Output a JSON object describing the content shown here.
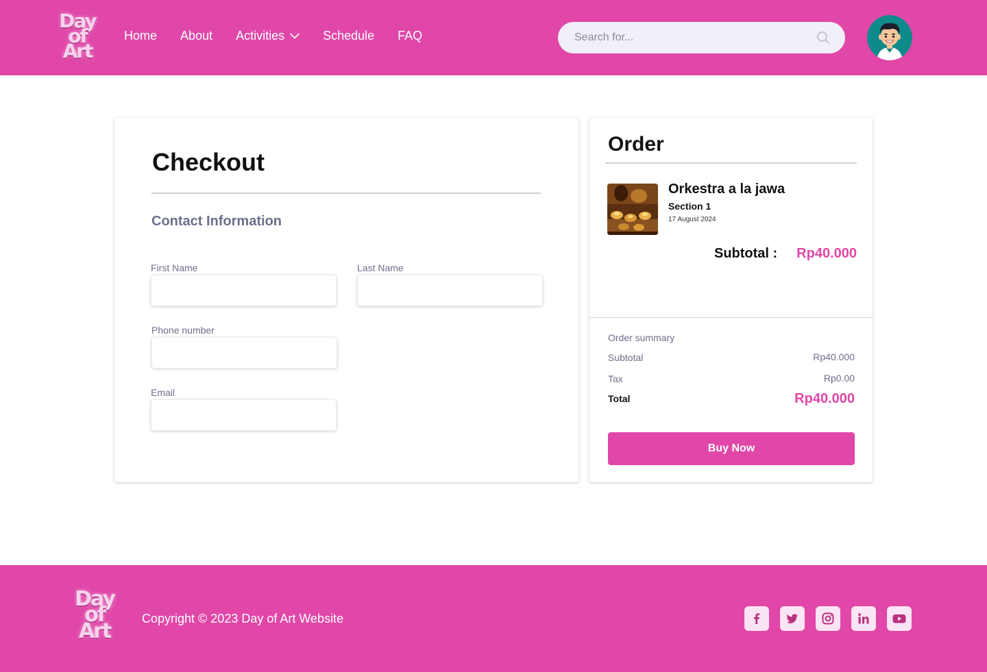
{
  "brand": {
    "logo_lines": [
      "Day",
      "of",
      "Art"
    ]
  },
  "nav": {
    "items": [
      {
        "label": "Home"
      },
      {
        "label": "About"
      },
      {
        "label": "Activities",
        "has_dropdown": true
      },
      {
        "label": "Schedule"
      },
      {
        "label": "FAQ"
      }
    ]
  },
  "search": {
    "placeholder": "Search for...",
    "value": ""
  },
  "checkout": {
    "title": "Checkout",
    "section_heading": "Contact Information",
    "fields": {
      "first_name": {
        "label": "First Name",
        "value": ""
      },
      "last_name": {
        "label": "Last Name",
        "value": ""
      },
      "phone": {
        "label": "Phone number",
        "value": ""
      },
      "email": {
        "label": "Email",
        "value": ""
      }
    }
  },
  "order": {
    "title": "Order",
    "item": {
      "name": "Orkestra a la jawa",
      "section": "Section 1",
      "date": "17 August 2024"
    },
    "subtotal_label": "Subtotal :",
    "subtotal_value": "Rp40.000",
    "summary": {
      "heading": "Order summary",
      "subtotal_label": "Subtotal",
      "subtotal_value": "Rp40.000",
      "tax_label": "Tax",
      "tax_value": "Rp0.00",
      "total_label": "Total",
      "total_value": "Rp40.000"
    },
    "buy_label": "Buy Now"
  },
  "footer": {
    "copyright": "Copyright © 2023 Day of Art Website",
    "socials": [
      "facebook-icon",
      "twitter-icon",
      "instagram-icon",
      "linkedin-icon",
      "youtube-icon"
    ]
  },
  "colors": {
    "brand_pink": "#e047a8",
    "text_muted": "#6c6f8a",
    "search_bg": "#f1eff8"
  }
}
